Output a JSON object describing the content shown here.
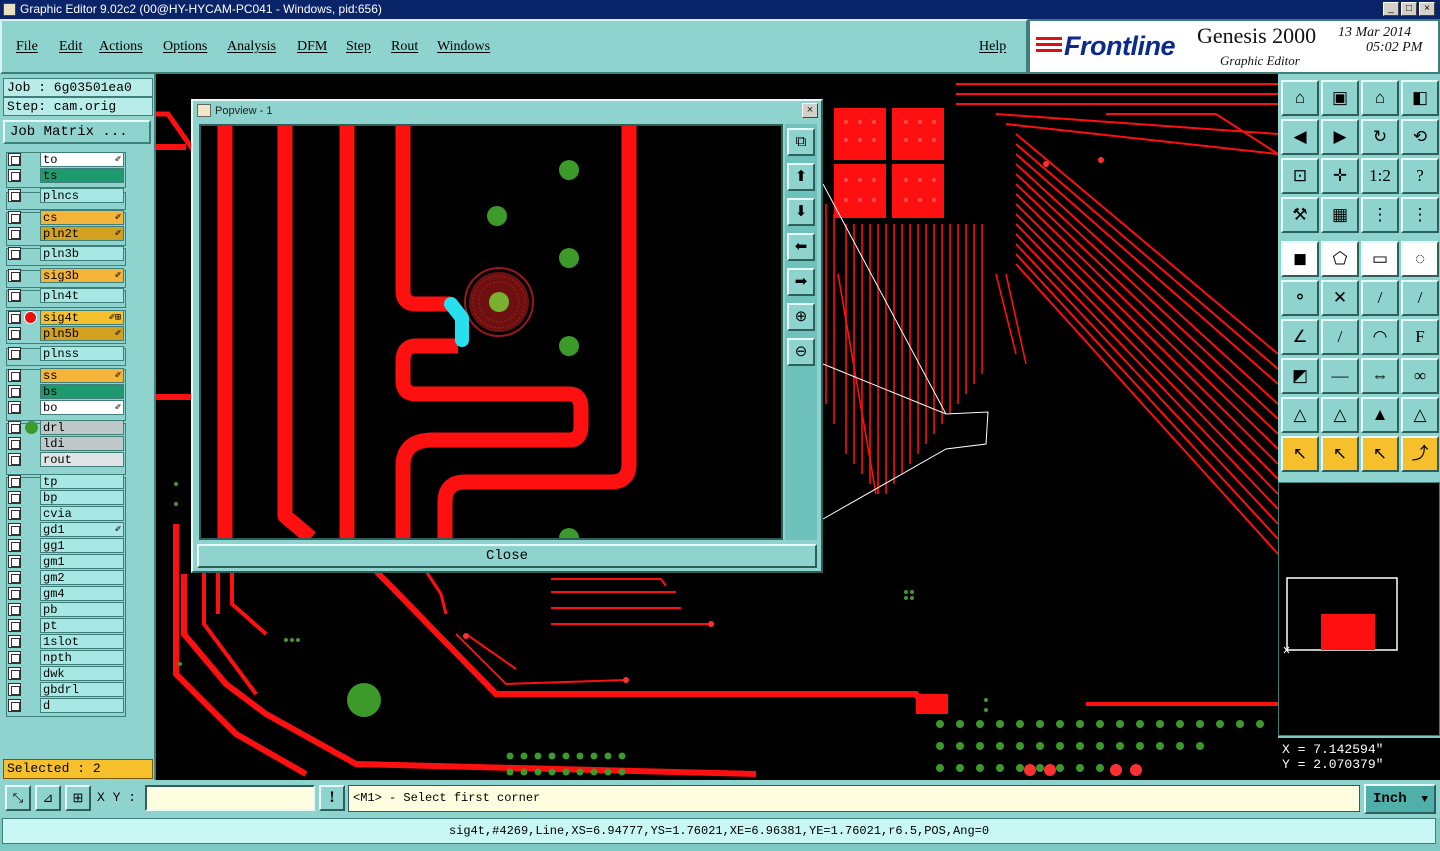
{
  "window": {
    "title": "Graphic Editor 9.02c2 (00@HY-HYCAM-PC041 - Windows, pid:656)"
  },
  "menu": {
    "file": "File",
    "edit": "Edit",
    "actions": "Actions",
    "options": "Options",
    "analysis": "Analysis",
    "dfm": "DFM",
    "step": "Step",
    "rout": "Rout",
    "windows": "Windows",
    "help": "Help"
  },
  "brand": {
    "logo": "Frontline",
    "product": "Genesis 2000",
    "subtitle": "Graphic Editor",
    "date": "13 Mar 2014",
    "time": "05:02 PM"
  },
  "job": {
    "job_label": "Job : 6g03501ea0",
    "step_label": "Step: cam.orig",
    "matrix_button": "Job Matrix ..."
  },
  "layers": [
    {
      "name": "to",
      "color": "#ffffff",
      "flag": "✐"
    },
    {
      "name": "ts",
      "color": "#1f9a6e",
      "flag": ""
    },
    {
      "name": "plncs",
      "color": "#a8e8e4",
      "flag": ""
    },
    {
      "name": "cs",
      "color": "#f5b43a",
      "flag": "✐"
    },
    {
      "name": "pln2t",
      "color": "#d4a020",
      "flag": "✐"
    },
    {
      "name": "pln3b",
      "color": "#a8e8e4",
      "flag": ""
    },
    {
      "name": "sig3b",
      "color": "#f5b43a",
      "flag": "✐"
    },
    {
      "name": "pln4t",
      "color": "#a8e8e4",
      "flag": ""
    },
    {
      "name": "sig4t",
      "color": "#f5c02b",
      "flag": "✐⊞"
    },
    {
      "name": "pln5b",
      "color": "#d4a020",
      "flag": "✐"
    },
    {
      "name": "plnss",
      "color": "#a8e8e4",
      "flag": ""
    },
    {
      "name": "ss",
      "color": "#f5b43a",
      "flag": "✐"
    },
    {
      "name": "bs",
      "color": "#1f9a6e",
      "flag": ""
    },
    {
      "name": "bo",
      "color": "#ffffff",
      "flag": "✐"
    },
    {
      "name": "drl",
      "color": "#c0c8c8",
      "flag": ""
    },
    {
      "name": "ldi",
      "color": "#c0c8c8",
      "flag": ""
    },
    {
      "name": "rout",
      "color": "#e0e4e4",
      "flag": ""
    },
    {
      "name": "tp",
      "color": "#a8e8e4",
      "flag": ""
    },
    {
      "name": "bp",
      "color": "#a8e8e4",
      "flag": ""
    },
    {
      "name": "cvia",
      "color": "#a8e8e4",
      "flag": ""
    },
    {
      "name": "gd1",
      "color": "#a8e8e4",
      "flag": "✐"
    },
    {
      "name": "gg1",
      "color": "#a8e8e4",
      "flag": ""
    },
    {
      "name": "gm1",
      "color": "#a8e8e4",
      "flag": ""
    },
    {
      "name": "gm2",
      "color": "#a8e8e4",
      "flag": ""
    },
    {
      "name": "gm4",
      "color": "#a8e8e4",
      "flag": ""
    },
    {
      "name": "pb",
      "color": "#a8e8e4",
      "flag": ""
    },
    {
      "name": "pt",
      "color": "#a8e8e4",
      "flag": ""
    },
    {
      "name": "1slot",
      "color": "#a8e8e4",
      "flag": ""
    },
    {
      "name": "npth",
      "color": "#a8e8e4",
      "flag": ""
    },
    {
      "name": "dwk",
      "color": "#a8e8e4",
      "flag": ""
    },
    {
      "name": "gbdrl",
      "color": "#a8e8e4",
      "flag": ""
    },
    {
      "name": "d",
      "color": "#a8e8e4",
      "flag": ""
    }
  ],
  "selected": "Selected : 2",
  "popview": {
    "title": "Popview - 1",
    "close_button": "Close"
  },
  "coords": {
    "x": "X = 7.142594\"",
    "y": "Y = 2.070379\""
  },
  "bottom": {
    "xy_label": "X Y :",
    "xy_value": "",
    "warn": "!",
    "prompt": "<M1> - Select first corner",
    "unit": "Inch",
    "status": "sig4t,#4269,Line,XS=6.94777,YS=1.76021,XE=6.96381,YE=1.76021,r6.5,POS,Ang=0"
  },
  "colors": {
    "trace": "#ff1010",
    "pad": "#3c9a2a",
    "highlight": "#26e0f0",
    "panel": "#8fd3ce"
  }
}
